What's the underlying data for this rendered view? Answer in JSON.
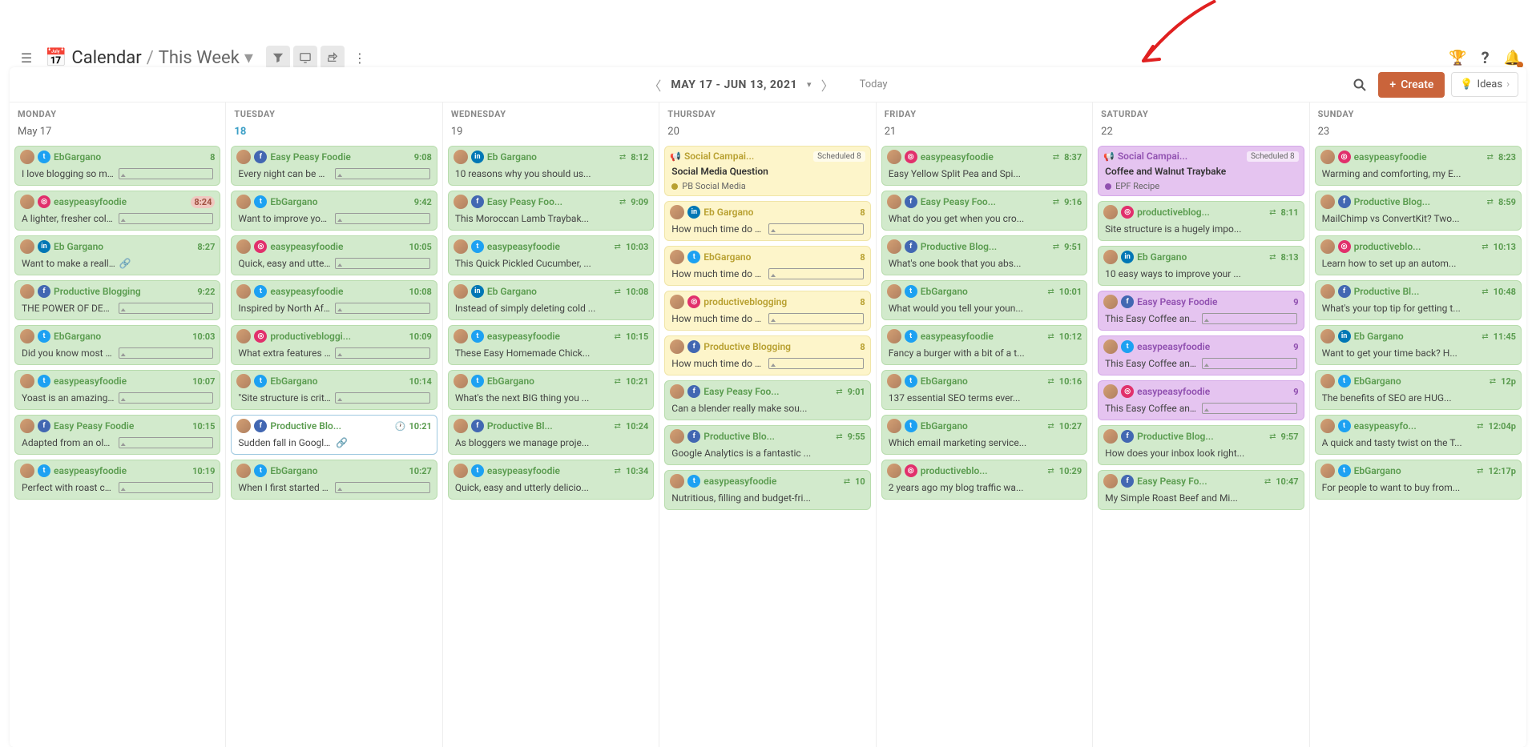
{
  "breadcrumb": {
    "icon": "calendar",
    "title": "Calendar",
    "sep": "/",
    "current": "This Week"
  },
  "dateRange": "MAY 17 - JUN 13, 2021",
  "today": "Today",
  "createLabel": "Create",
  "ideasLabel": "Ideas",
  "days": [
    {
      "name": "MONDAY",
      "num": "May 17",
      "current": false,
      "cards": [
        {
          "c": "green",
          "plats": [
            "tw"
          ],
          "acct": "EbGargano",
          "time": "8",
          "body": "I love blogging so much it n...",
          "media": true
        },
        {
          "c": "green",
          "plats": [
            "ig"
          ],
          "acct": "easypeasyfoodie",
          "time": "8:24",
          "timeBadge": true,
          "body": "A lighter, fresher coleslaw......",
          "media": true
        },
        {
          "c": "green",
          "plats": [
            "ld"
          ],
          "acct": "Eb Gargano",
          "time": "8:27",
          "body": "Want to make a really great...",
          "link": true
        },
        {
          "c": "green",
          "plats": [
            "fb"
          ],
          "acct": "Productive Blogging",
          "time": "9:22",
          "body": "THE POWER OF DEADLIN...",
          "media": true
        },
        {
          "c": "green",
          "plats": [
            "tw"
          ],
          "acct": "EbGargano",
          "time": "10:03",
          "body": "Did you know most blogger...",
          "media": true
        },
        {
          "c": "green",
          "plats": [
            "tw"
          ],
          "acct": "easypeasyfoodie",
          "time": "10:07",
          "body": "Yoast is an amazing tool th...",
          "media": true
        },
        {
          "c": "green",
          "plats": [
            "fb"
          ],
          "acct": "Easy Peasy Foodie",
          "time": "10:15",
          "body": "Adapted from an old family ...",
          "media": true
        },
        {
          "c": "green",
          "plats": [
            "tw"
          ],
          "acct": "easypeasyfoodie",
          "time": "10:19",
          "body": "Perfect with roast chicken o...",
          "media": true
        }
      ]
    },
    {
      "name": "TUESDAY",
      "num": "18",
      "current": true,
      "cards": [
        {
          "c": "green",
          "plats": [
            "fb"
          ],
          "acct": "Easy Peasy Foodie",
          "time": "9:08",
          "body": "Every night can be Mexican...",
          "media": true
        },
        {
          "c": "green",
          "plats": [
            "tw"
          ],
          "acct": "EbGargano",
          "time": "9:42",
          "body": "Want to improve your SEO, ...",
          "media": true
        },
        {
          "c": "green",
          "plats": [
            "ig"
          ],
          "acct": "easypeasyfoodie",
          "time": "10:05",
          "body": "Quick, easy and utterly deli...",
          "media": true
        },
        {
          "c": "green",
          "plats": [
            "tw"
          ],
          "acct": "easypeasyfoodie",
          "time": "10:08",
          "body": "Inspired by North African fla...",
          "media": true
        },
        {
          "c": "green",
          "plats": [
            "ig"
          ],
          "acct": "productivebloggi...",
          "time": "10:09",
          "body": "What extra features do you ...",
          "media": true
        },
        {
          "c": "green",
          "plats": [
            "tw"
          ],
          "acct": "EbGargano",
          "time": "10:14",
          "body": "\"Site structure is critical for ...",
          "media": true
        },
        {
          "c": "blue",
          "plats": [
            "fb"
          ],
          "acct": "Productive Blo...",
          "time": "10:21",
          "clock": true,
          "body": "Sudden fall in Google traffic...",
          "link": true
        },
        {
          "c": "green",
          "plats": [
            "tw"
          ],
          "acct": "EbGargano",
          "time": "10:27",
          "body": "When I first started my blog...",
          "media": true
        }
      ]
    },
    {
      "name": "WEDNESDAY",
      "num": "19",
      "current": false,
      "cards": [
        {
          "c": "green",
          "plats": [
            "ld"
          ],
          "acct": "Eb Gargano",
          "time": "8:12",
          "sh": true,
          "body": "10 reasons why you should us..."
        },
        {
          "c": "green",
          "plats": [
            "fb"
          ],
          "acct": "Easy Peasy Foo...",
          "time": "9:09",
          "sh": true,
          "body": "This Moroccan Lamb Traybak..."
        },
        {
          "c": "green",
          "plats": [
            "tw"
          ],
          "acct": "easypeasyfoodie",
          "time": "10:03",
          "sh": true,
          "body": "This Quick Pickled Cucumber, ..."
        },
        {
          "c": "green",
          "plats": [
            "ld"
          ],
          "acct": "Eb Gargano",
          "time": "10:08",
          "sh": true,
          "body": "Instead of simply deleting cold ..."
        },
        {
          "c": "green",
          "plats": [
            "tw"
          ],
          "acct": "easypeasyfoodie",
          "time": "10:15",
          "sh": true,
          "body": "These Easy Homemade Chick..."
        },
        {
          "c": "green",
          "plats": [
            "tw"
          ],
          "acct": "EbGargano",
          "time": "10:21",
          "sh": true,
          "body": "What's the next BIG thing you ..."
        },
        {
          "c": "green",
          "plats": [
            "fb"
          ],
          "acct": "Productive Bl...",
          "time": "10:24",
          "sh": true,
          "body": "As bloggers we manage proje..."
        },
        {
          "c": "green",
          "plats": [
            "tw"
          ],
          "acct": "easypeasyfoodie",
          "time": "10:34",
          "sh": true,
          "body": "Quick, easy and utterly delicio..."
        }
      ]
    },
    {
      "name": "THURSDAY",
      "num": "20",
      "current": false,
      "cards": [
        {
          "c": "yellow",
          "campaign": true,
          "campTitle": "Social Campai...",
          "status": "Scheduled",
          "count": "8",
          "sub": "Social Media Question",
          "tag": "PB Social Media",
          "dotColor": "olive"
        },
        {
          "c": "yellow",
          "plats": [
            "ld"
          ],
          "acct": "Eb Gargano",
          "time": "8",
          "body": "How much time do you usu...",
          "media": true,
          "acctClass": "yellow",
          "timeClass": "yellow"
        },
        {
          "c": "yellow",
          "plats": [
            "tw"
          ],
          "acct": "EbGargano",
          "time": "8",
          "body": "How much time do you usu...",
          "media": true,
          "acctClass": "yellow",
          "timeClass": "yellow"
        },
        {
          "c": "yellow",
          "plats": [
            "ig"
          ],
          "acct": "productiveblogging",
          "time": "8",
          "body": "How much time do you usu...",
          "media": true,
          "acctClass": "yellow",
          "timeClass": "yellow"
        },
        {
          "c": "yellow",
          "plats": [
            "fb"
          ],
          "acct": "Productive Blogging",
          "time": "8",
          "body": "How much time do you usu...",
          "media": true,
          "acctClass": "yellow",
          "timeClass": "yellow"
        },
        {
          "c": "green",
          "plats": [
            "fb"
          ],
          "acct": "Easy Peasy Foo...",
          "time": "9:01",
          "sh": true,
          "body": "Can a blender really make sou..."
        },
        {
          "c": "green",
          "plats": [
            "fb"
          ],
          "acct": "Productive Blo...",
          "time": "9:55",
          "sh": true,
          "body": "Google Analytics is a fantastic ..."
        },
        {
          "c": "green",
          "plats": [
            "tw"
          ],
          "acct": "easypeasyfoodie",
          "time": "10",
          "sh": true,
          "body": "Nutritious, filling and budget-fri..."
        }
      ]
    },
    {
      "name": "FRIDAY",
      "num": "21",
      "current": false,
      "cards": [
        {
          "c": "green",
          "plats": [
            "ig"
          ],
          "acct": "easypeasyfoodie",
          "time": "8:37",
          "sh": true,
          "body": "Easy Yellow Split Pea and Spi..."
        },
        {
          "c": "green",
          "plats": [
            "fb"
          ],
          "acct": "Easy Peasy Foo...",
          "time": "9:16",
          "sh": true,
          "body": "What do you get when you cro..."
        },
        {
          "c": "green",
          "plats": [
            "fb"
          ],
          "acct": "Productive Blog...",
          "time": "9:51",
          "sh": true,
          "body": "What's one book that you abs..."
        },
        {
          "c": "green",
          "plats": [
            "tw"
          ],
          "acct": "EbGargano",
          "time": "10:01",
          "sh": true,
          "body": "What would you tell your youn..."
        },
        {
          "c": "green",
          "plats": [
            "tw"
          ],
          "acct": "easypeasyfoodie",
          "time": "10:12",
          "sh": true,
          "body": "Fancy a burger with a bit of a t..."
        },
        {
          "c": "green",
          "plats": [
            "tw"
          ],
          "acct": "EbGargano",
          "time": "10:16",
          "sh": true,
          "body": "137 essential SEO terms ever..."
        },
        {
          "c": "green",
          "plats": [
            "tw"
          ],
          "acct": "EbGargano",
          "time": "10:27",
          "sh": true,
          "body": "Which email marketing service..."
        },
        {
          "c": "green",
          "plats": [
            "ig"
          ],
          "acct": "productiveblo...",
          "time": "10:29",
          "sh": true,
          "body": "2 years ago my blog traffic wa..."
        }
      ]
    },
    {
      "name": "SATURDAY",
      "num": "22",
      "current": false,
      "cards": [
        {
          "c": "purple",
          "campaign": true,
          "campTitle": "Social Campai...",
          "status": "Scheduled",
          "count": "8",
          "sub": "Coffee and Walnut Traybake",
          "tag": "EPF Recipe",
          "dotColor": "purple",
          "campClass": "purple"
        },
        {
          "c": "green",
          "plats": [
            "ig"
          ],
          "acct": "productiveblog...",
          "time": "8:11",
          "sh": true,
          "body": "Site structure is a hugely impo..."
        },
        {
          "c": "green",
          "plats": [
            "ld"
          ],
          "acct": "Eb Gargano",
          "time": "8:13",
          "sh": true,
          "body": "10 easy ways to improve your ..."
        },
        {
          "c": "purple",
          "plats": [
            "fb"
          ],
          "acct": "Easy Peasy Foodie",
          "time": "9",
          "body": "This Easy Coffee and Waln...",
          "media": true,
          "acctClass": "purple",
          "timeClass": "purple"
        },
        {
          "c": "purple",
          "plats": [
            "tw"
          ],
          "acct": "easypeasyfoodie",
          "time": "9",
          "body": "This Easy Coffee and Waln...",
          "media": true,
          "acctClass": "purple",
          "timeClass": "purple"
        },
        {
          "c": "purple",
          "plats": [
            "ig"
          ],
          "acct": "easypeasyfoodie",
          "time": "9",
          "body": "This Easy Coffee and Waln...",
          "media": true,
          "acctClass": "purple",
          "timeClass": "purple"
        },
        {
          "c": "green",
          "plats": [
            "fb"
          ],
          "acct": "Productive Blog...",
          "time": "9:57",
          "sh": true,
          "body": "How does your inbox look right..."
        },
        {
          "c": "green",
          "plats": [
            "fb"
          ],
          "acct": "Easy Peasy Fo...",
          "time": "10:47",
          "sh": true,
          "body": "My Simple Roast Beef and Mi..."
        }
      ]
    },
    {
      "name": "SUNDAY",
      "num": "23",
      "current": false,
      "cards": [
        {
          "c": "green",
          "plats": [
            "ig"
          ],
          "acct": "easypeasyfoodie",
          "time": "8:23",
          "sh": true,
          "body": "Warming and comforting, my E..."
        },
        {
          "c": "green",
          "plats": [
            "fb"
          ],
          "acct": "Productive Blog...",
          "time": "8:59",
          "sh": true,
          "body": "MailChimp vs ConvertKit? Two..."
        },
        {
          "c": "green",
          "plats": [
            "ig"
          ],
          "acct": "productiveblo...",
          "time": "10:13",
          "sh": true,
          "body": "Learn how to set up an autom..."
        },
        {
          "c": "green",
          "plats": [
            "fb"
          ],
          "acct": "Productive Bl...",
          "time": "10:48",
          "sh": true,
          "body": "What's your top tip for getting t..."
        },
        {
          "c": "green",
          "plats": [
            "ld"
          ],
          "acct": "Eb Gargano",
          "time": "11:45",
          "sh": true,
          "body": "Want to get your time back? H..."
        },
        {
          "c": "green",
          "plats": [
            "tw"
          ],
          "acct": "EbGargano",
          "time": "12p",
          "sh": true,
          "body": "The benefits of SEO are HUG..."
        },
        {
          "c": "green",
          "plats": [
            "tw"
          ],
          "acct": "easypeasyfo...",
          "time": "12:04p",
          "sh": true,
          "body": "A quick and tasty twist on the T..."
        },
        {
          "c": "green",
          "plats": [
            "tw"
          ],
          "acct": "EbGargano",
          "time": "12:17p",
          "sh": true,
          "body": "For people to want to buy from..."
        }
      ]
    }
  ]
}
